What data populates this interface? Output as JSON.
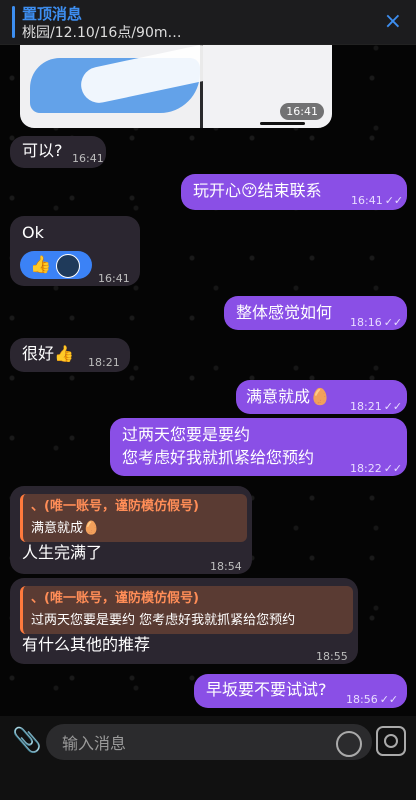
{
  "pinned": {
    "title": "置顶消息",
    "preview": "桃园/12.10/16点/90m…",
    "close_icon": "×"
  },
  "photo": {
    "time": "16:41"
  },
  "messages": [
    {
      "dir": "in",
      "text": "可以?",
      "time": "16:41"
    },
    {
      "dir": "out",
      "text": "玩开心😚结束联系",
      "time": "16:41"
    },
    {
      "dir": "in",
      "text": "Ok",
      "time": "16:41",
      "reaction": "👍"
    },
    {
      "dir": "out",
      "text": "整体感觉如何",
      "time": "18:16"
    },
    {
      "dir": "in",
      "text": "很好👍",
      "time": "18:21"
    },
    {
      "dir": "out",
      "text": "满意就成🥚",
      "time": "18:21"
    },
    {
      "dir": "out",
      "line1": "过两天您要是要约",
      "line2": "您考虑好我就抓紧给您预约",
      "time": "18:22"
    },
    {
      "dir": "in",
      "reply_name": "、(唯一账号，谨防模仿假号)",
      "reply_text": "满意就成🥚",
      "text": "人生完满了",
      "time": "18:54"
    },
    {
      "dir": "in",
      "reply_name": "、(唯一账号，谨防模仿假号)",
      "reply_text": "过两天您要是要约 您考虑好我就抓紧给您预约",
      "text": "有什么其他的推荐",
      "time": "18:55"
    },
    {
      "dir": "out",
      "text": "早坂要不要试试?",
      "time": "18:56"
    }
  ],
  "ticks": "✓✓",
  "input": {
    "placeholder": "输入消息"
  },
  "icons": {
    "attach": "paperclip-icon",
    "sticker": "sticker-icon",
    "voice": "microphone-icon",
    "close": "close-icon"
  },
  "colors": {
    "outgoing": "#8a4fe6",
    "incoming": "#2b2630",
    "accent": "#3d8ef0"
  }
}
